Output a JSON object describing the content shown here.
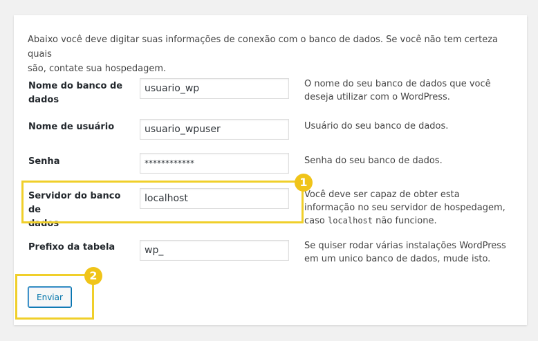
{
  "intro_line1": "Abaixo você deve digitar suas informações de conexão com o banco de dados. Se você não tem certeza quais",
  "intro_line2": "são, contate sua hospedagem.",
  "rows": [
    {
      "label_line1": "Nome do banco de",
      "label_line2": "dados",
      "value": "usuario_wp",
      "desc_line1": "O nome do seu banco de dados que você",
      "desc_line2": "deseja utilizar com o WordPress."
    },
    {
      "label_line1": "Nome de usuário",
      "value": "usuario_wpuser",
      "desc_line1": "Usuário do seu banco de dados."
    },
    {
      "label_line1": "Senha",
      "value": "************",
      "desc_line1": "Senha do seu banco de dados."
    },
    {
      "label_line1": "Servidor do banco de",
      "label_line2": "dados",
      "value": "localhost",
      "desc_line1": "Você deve ser capaz de obter esta",
      "desc_line2": "informação no seu servidor de hospedagem,",
      "desc_line3_pre": "caso ",
      "desc_line3_code": "localhost",
      "desc_line3_post": " não funcione."
    },
    {
      "label_line1": "Prefixo da tabela",
      "value": "wp_",
      "desc_line1": "Se quiser rodar várias instalações WordPress",
      "desc_line2": "em um unico banco de dados, mude isto."
    }
  ],
  "submit_label": "Enviar",
  "badges": [
    "1",
    "2"
  ],
  "colors": {
    "highlight": "#f0cf2a",
    "badge": "#f0c419",
    "button_border": "#0073aa"
  }
}
